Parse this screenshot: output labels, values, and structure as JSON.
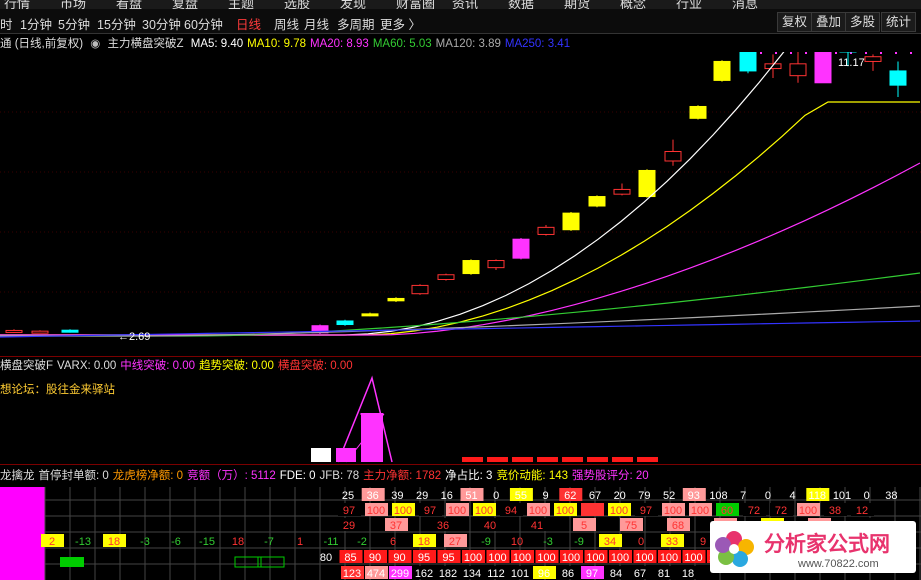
{
  "topnav": [
    "行情",
    "市场",
    "看盘",
    "复盘",
    "主题",
    "选股",
    "发现",
    "财富圈",
    "资讯",
    "数据",
    "期货",
    "概念",
    "行业",
    "消息"
  ],
  "toolbar": {
    "periods": [
      {
        "label": "时",
        "active": false
      },
      {
        "label": "1分钟",
        "active": false
      },
      {
        "label": "5分钟",
        "active": false
      },
      {
        "label": "15分钟",
        "active": false
      },
      {
        "label": "30分钟",
        "active": false
      },
      {
        "label": "60分钟",
        "active": false
      },
      {
        "label": "日线",
        "active": true
      },
      {
        "label": "周线",
        "active": false
      },
      {
        "label": "月线",
        "active": false
      },
      {
        "label": "多周期",
        "active": false
      },
      {
        "label": "更多 〉",
        "active": false
      }
    ],
    "right_buttons": [
      "复权",
      "叠加",
      "多股",
      "统计"
    ]
  },
  "main_legend": {
    "prefix": "通 (日线,前复权)",
    "indicator": "主力横盘突破Z",
    "items": [
      {
        "text": "MA5: 9.40",
        "color": "#ffffff"
      },
      {
        "text": "MA10: 9.78",
        "color": "#ffff00"
      },
      {
        "text": "MA20: 8.93",
        "color": "#ff33ff"
      },
      {
        "text": "MA60: 5.03",
        "color": "#33cc33"
      },
      {
        "text": "MA120: 3.89",
        "color": "#aaaaaa"
      },
      {
        "text": "MA250: 3.41",
        "color": "#3333ff"
      }
    ]
  },
  "main_annotations": {
    "high": "11.17",
    "low": "←2.69"
  },
  "sub_legend": {
    "items": [
      {
        "text": "横盘突破F",
        "color": "#dddddd"
      },
      {
        "text": "VARX: 0.00",
        "color": "#dddddd"
      },
      {
        "text": "中线突破: 0.00",
        "color": "#ff33ff"
      },
      {
        "text": "趋势突破: 0.00",
        "color": "#ffff00"
      },
      {
        "text": "横盘突破: 0.00",
        "color": "#ff3333"
      }
    ],
    "forum": "想论坛：股往金来驿站"
  },
  "table_legend": {
    "items": [
      {
        "text": "龙擒龙",
        "color": "#dddddd"
      },
      {
        "text": "首停封单额: 0",
        "color": "#dddddd"
      },
      {
        "text": "龙虎榜净额: 0",
        "color": "#ff9900"
      },
      {
        "text": "竞额（万）: 5112",
        "color": "#ff33ff"
      },
      {
        "text": "FDE: 0",
        "color": "#ffffff"
      },
      {
        "text": "JFB: 78",
        "color": "#dddddd"
      },
      {
        "text": "主力净额: 1782",
        "color": "#ff3333"
      },
      {
        "text": "净占比: 3",
        "color": "#ffffff"
      },
      {
        "text": "竞价动能: 143",
        "color": "#ffff00"
      },
      {
        "text": "强势股评分: 20",
        "color": "#ff33ff"
      }
    ]
  },
  "table": {
    "row1": [
      "25",
      "36",
      "39",
      "29",
      "16",
      "51",
      "0",
      "55",
      "9",
      "62",
      "67",
      "20",
      "79",
      "52",
      "93",
      "108",
      "7",
      "0",
      "4",
      "118",
      "101",
      "0",
      "38"
    ],
    "row2": [
      "97",
      "100",
      "100",
      "97",
      "100",
      "100",
      "94",
      "100",
      "100",
      "98",
      "100",
      "97",
      "100",
      "100",
      "60",
      "72",
      "72",
      "100",
      "38",
      "12"
    ],
    "row3": [
      "29",
      "37",
      "36",
      "40",
      "41",
      "5",
      "75",
      "68",
      "80",
      "119",
      "87",
      "29"
    ],
    "row4": [
      "2",
      "-13",
      "18",
      "-3",
      "-6",
      "-15",
      "18",
      "-7",
      "1",
      "-11",
      "-2",
      "6",
      "18",
      "27",
      "-9",
      "10",
      "-3",
      "-9",
      "34",
      "0",
      "33",
      "9",
      "-4",
      "19",
      "-3",
      "-5",
      "9",
      "-7"
    ],
    "row5": [
      "80",
      "85",
      "90",
      "90",
      "95",
      "95",
      "100",
      "100",
      "100",
      "100",
      "100",
      "100",
      "100",
      "100",
      "100",
      "100",
      "100"
    ],
    "row6": [
      "123",
      "474",
      "299",
      "162",
      "182",
      "134",
      "112",
      "101",
      "96",
      "86",
      "97",
      "84",
      "67",
      "81",
      "18"
    ]
  },
  "watermark": {
    "text": "分析家公式网",
    "url": "www.70822.com"
  },
  "chart_data": {
    "type": "candlestick",
    "y_markers": {
      "high": 11.17,
      "low": 2.69
    },
    "ma_values": {
      "MA5": 9.4,
      "MA10": 9.78,
      "MA20": 8.93,
      "MA60": 5.03,
      "MA120": 3.89,
      "MA250": 3.41
    },
    "series": [
      {
        "name": "MA5",
        "color": "#ffffff"
      },
      {
        "name": "MA10",
        "color": "#ffff00"
      },
      {
        "name": "MA20",
        "color": "#ff33ff"
      },
      {
        "name": "MA60",
        "color": "#33cc33"
      },
      {
        "name": "MA120",
        "color": "#aaaaaa"
      },
      {
        "name": "MA250",
        "color": "#3333ff"
      }
    ]
  }
}
